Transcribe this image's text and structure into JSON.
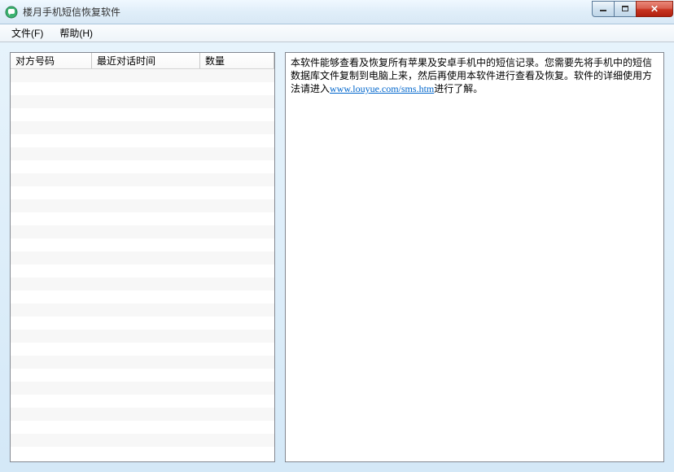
{
  "window": {
    "title": "楼月手机短信恢复软件"
  },
  "menu": {
    "file": "文件(F)",
    "help": "帮助(H)"
  },
  "table": {
    "headers": {
      "phone": "对方号码",
      "time": "最近对话时间",
      "count": "数量"
    }
  },
  "content": {
    "text_before": "本软件能够查看及恢复所有苹果及安卓手机中的短信记录。您需要先将手机中的短信数据库文件复制到电脑上来，然后再使用本软件进行查看及恢复。软件的详细使用方法请进入",
    "link_text": "www.louyue.com/sms.htm",
    "text_after": "进行了解。"
  }
}
